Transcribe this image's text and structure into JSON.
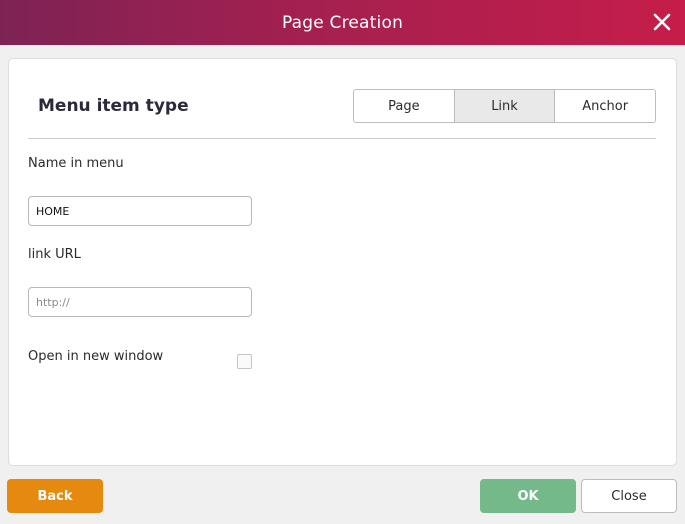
{
  "dialog": {
    "title": "Page Creation",
    "close_icon": "close-icon"
  },
  "form": {
    "section_title": "Menu item type",
    "menu_types": [
      "Page",
      "Link",
      "Anchor"
    ],
    "selected_type": "Link",
    "name_label": "Name in menu",
    "name_value": "HOME",
    "link_label": "link URL",
    "link_value": "",
    "link_placeholder": "http://",
    "new_window_label": "Open in new window",
    "new_window_checked": false
  },
  "footer": {
    "back_label": "Back",
    "ok_label": "OK",
    "close_label": "Close"
  },
  "colors": {
    "titlebar_start": "#7d2354",
    "titlebar_end": "#c61d4a",
    "back_button": "#e58a0e",
    "ok_button": "#74b98a"
  }
}
